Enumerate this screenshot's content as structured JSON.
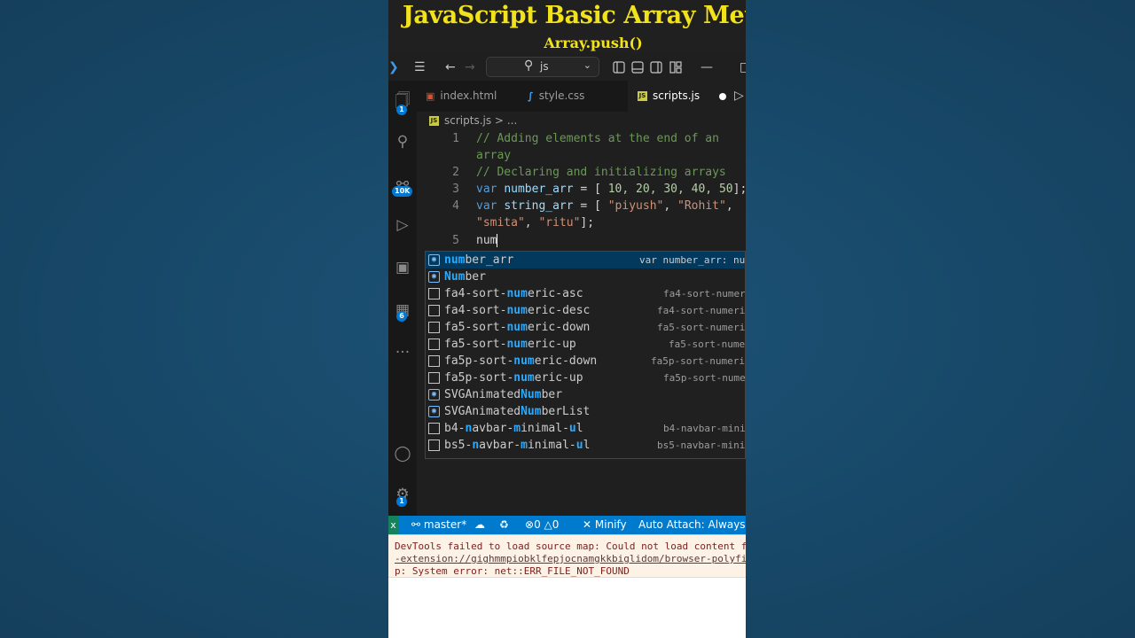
{
  "banner": {
    "title": "JavaScript Basic Array Meth",
    "subtitle": "Array.push()"
  },
  "titlebar": {
    "search_text": "js"
  },
  "activity": {
    "explorer_badge": "1",
    "scm_badge": "10K",
    "extensions_badge": "6",
    "settings_badge": "1",
    "more": "..."
  },
  "tabs": [
    {
      "label": "index.html",
      "icon": "html-icon",
      "color": "#e34c26"
    },
    {
      "label": "style.css",
      "icon": "css-icon",
      "color": "#42a5f5"
    },
    {
      "label": "scripts.js",
      "icon": "js-icon",
      "color": "#cbcb41"
    }
  ],
  "breadcrumb": {
    "file": "scripts.js",
    "sep": ">",
    "rest": "..."
  },
  "editor": {
    "line_numbers": [
      "1",
      "2",
      "3",
      "4",
      "5"
    ],
    "line1a": "// Adding elements at the end of an",
    "line1b": "array",
    "line2": "// Declaring and initializing arrays",
    "line3": {
      "kw": "var",
      "name": "number_arr",
      "eq": " = [ ",
      "vals": "10, 20, 30, 40, 50",
      "end": "];"
    },
    "line4": {
      "kw": "var",
      "name": "string_arr",
      "eq": " = [ ",
      "s1": "\"piyush\"",
      "comma1": ", ",
      "s2": "\"Rohit\"",
      "comma2": ",",
      "s3": "\"smita\"",
      "comma3": ", ",
      "s4": "\"ritu\"",
      "end": "];"
    },
    "line5": "num"
  },
  "suggestions": [
    {
      "match": "num",
      "rest": "ber_arr",
      "detail": "var number_arr: nu",
      "kind": "variable",
      "selected": true
    },
    {
      "match": "Num",
      "rest": "ber",
      "detail": "",
      "kind": "variable"
    },
    {
      "pre": "fa4-sort-",
      "match": "num",
      "rest": "eric-asc",
      "detail": "fa4-sort-numer",
      "kind": "snippet"
    },
    {
      "pre": "fa4-sort-",
      "match": "num",
      "rest": "eric-desc",
      "detail": "fa4-sort-numeri",
      "kind": "snippet"
    },
    {
      "pre": "fa5-sort-",
      "match": "num",
      "rest": "eric-down",
      "detail": "fa5-sort-numeri",
      "kind": "snippet"
    },
    {
      "pre": "fa5-sort-",
      "match": "num",
      "rest": "eric-up",
      "detail": "fa5-sort-nume",
      "kind": "snippet"
    },
    {
      "pre": "fa5p-sort-",
      "match": "num",
      "rest": "eric-down",
      "detail": "fa5p-sort-numeri",
      "kind": "snippet"
    },
    {
      "pre": "fa5p-sort-",
      "match": "num",
      "rest": "eric-up",
      "detail": "fa5p-sort-nume",
      "kind": "snippet"
    },
    {
      "pre": "SVGAnimated",
      "match": "Num",
      "rest": "ber",
      "detail": "",
      "kind": "variable"
    },
    {
      "pre": "SVGAnimated",
      "match": "Num",
      "rest": "berList",
      "detail": "",
      "kind": "variable"
    },
    {
      "pre": "b4-",
      "match": "n",
      "rest": "avbar-",
      "m2": "m",
      "r2": "inimal-",
      "m3": "u",
      "r3": "l",
      "detail": "b4-navbar-mini",
      "kind": "snippet"
    },
    {
      "pre": "bs5-",
      "match": "n",
      "rest": "avbar-",
      "m2": "m",
      "r2": "inimal-",
      "m3": "u",
      "r3": "l",
      "detail": "bs5-navbar-mini",
      "kind": "snippet"
    }
  ],
  "status": {
    "remote_icon": "x",
    "branch": "master*",
    "errors": "0",
    "warnings": "0",
    "minify": "Minify",
    "auto_attach": "Auto Attach: Always"
  },
  "devtools": {
    "line1": "DevTools failed to load source map: Could not load content for",
    "line2": "-extension://gighmmpiobklfepjocnamgkkbiglidom/browser-polyfill",
    "line3": "p: System error: net::ERR_FILE_NOT_FOUND"
  },
  "colors": {
    "banner_text": "#f2e21b",
    "status_bar": "#007acc",
    "match_highlight": "#2aaaff"
  }
}
